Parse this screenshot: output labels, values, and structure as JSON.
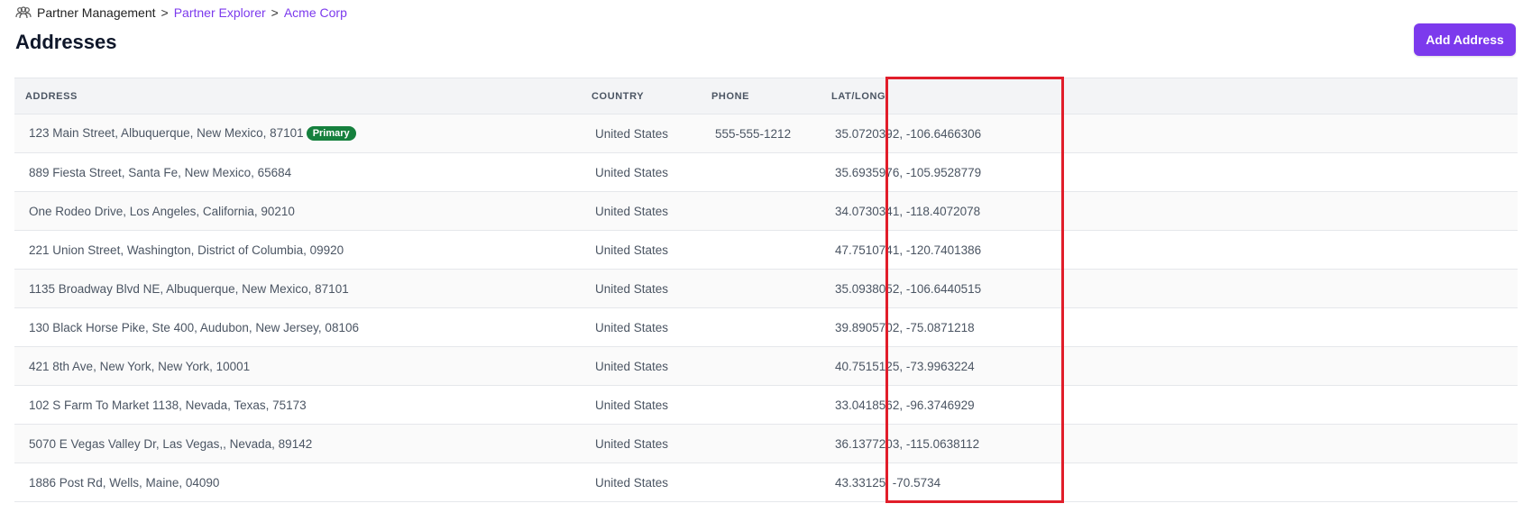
{
  "breadcrumb": {
    "root": "Partner Management",
    "sep1": ">",
    "explorer": "Partner Explorer",
    "sep2": ">",
    "current": "Acme Corp"
  },
  "header": {
    "title": "Addresses",
    "add_label": "Add Address"
  },
  "table": {
    "columns": [
      "ADDRESS",
      "COUNTRY",
      "PHONE",
      "LAT/LONG"
    ],
    "primary_badge": "Primary",
    "rows": [
      {
        "address": "123 Main Street, Albuquerque, New Mexico, 87101",
        "primary": true,
        "country": "United States",
        "phone": "555-555-1212",
        "latlong": "35.0720392, -106.6466306"
      },
      {
        "address": "889 Fiesta Street, Santa Fe, New Mexico, 65684",
        "primary": false,
        "country": "United States",
        "phone": "",
        "latlong": "35.6935976, -105.9528779"
      },
      {
        "address": "One Rodeo Drive, Los Angeles, California, 90210",
        "primary": false,
        "country": "United States",
        "phone": "",
        "latlong": "34.0730341, -118.4072078"
      },
      {
        "address": "221 Union Street, Washington, District of Columbia, 09920",
        "primary": false,
        "country": "United States",
        "phone": "",
        "latlong": "47.7510741, -120.7401386"
      },
      {
        "address": "1135 Broadway Blvd NE, Albuquerque, New Mexico, 87101",
        "primary": false,
        "country": "United States",
        "phone": "",
        "latlong": "35.0938052, -106.6440515"
      },
      {
        "address": "130 Black Horse Pike, Ste 400, Audubon, New Jersey, 08106",
        "primary": false,
        "country": "United States",
        "phone": "",
        "latlong": "39.8905702, -75.0871218"
      },
      {
        "address": "421 8th Ave, New York, New York, 10001",
        "primary": false,
        "country": "United States",
        "phone": "",
        "latlong": "40.7515125, -73.9963224"
      },
      {
        "address": "102 S Farm To Market 1138, Nevada, Texas, 75173",
        "primary": false,
        "country": "United States",
        "phone": "",
        "latlong": "33.0418562, -96.3746929"
      },
      {
        "address": "5070 E Vegas Valley Dr, Las Vegas,, Nevada, 89142",
        "primary": false,
        "country": "United States",
        "phone": "",
        "latlong": "36.1377203, -115.0638112"
      },
      {
        "address": "1886 Post Rd, Wells, Maine, 04090",
        "primary": false,
        "country": "United States",
        "phone": "",
        "latlong": "43.33125, -70.5734"
      }
    ]
  },
  "colors": {
    "accent": "#7c3aed",
    "badge": "#15803d",
    "highlight": "#e11d2a"
  },
  "icons": {
    "breadcrumb": "users-icon"
  }
}
